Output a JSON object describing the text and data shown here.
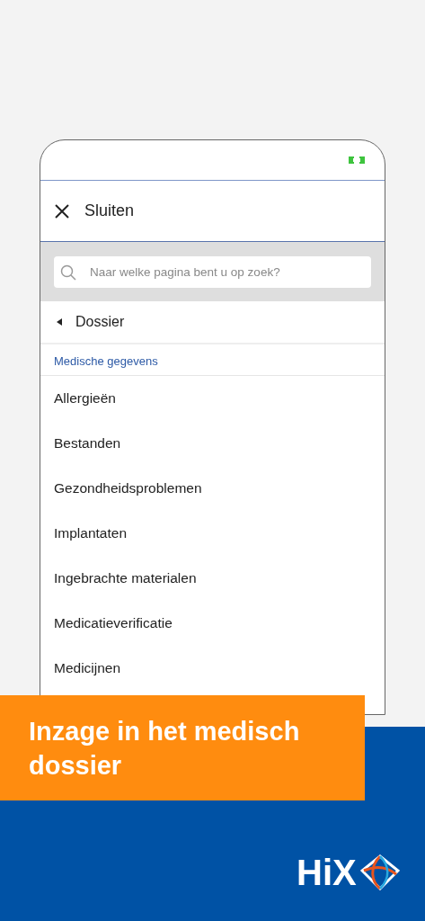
{
  "header": {
    "close_label": "Sluiten"
  },
  "search": {
    "placeholder": "Naar welke pagina bent u op zoek?"
  },
  "breadcrumb": {
    "label": "Dossier"
  },
  "section": {
    "title": "Medische gegevens"
  },
  "menu_items": [
    {
      "label": "Allergieën"
    },
    {
      "label": "Bestanden"
    },
    {
      "label": "Gezondheidsproblemen"
    },
    {
      "label": "Implantaten"
    },
    {
      "label": "Ingebrachte materialen"
    },
    {
      "label": "Medicatieverificatie"
    },
    {
      "label": "Medicijnen"
    }
  ],
  "banner": {
    "title": "Inzage in het medisch dossier"
  },
  "brand": {
    "logo_text": "HiX"
  }
}
